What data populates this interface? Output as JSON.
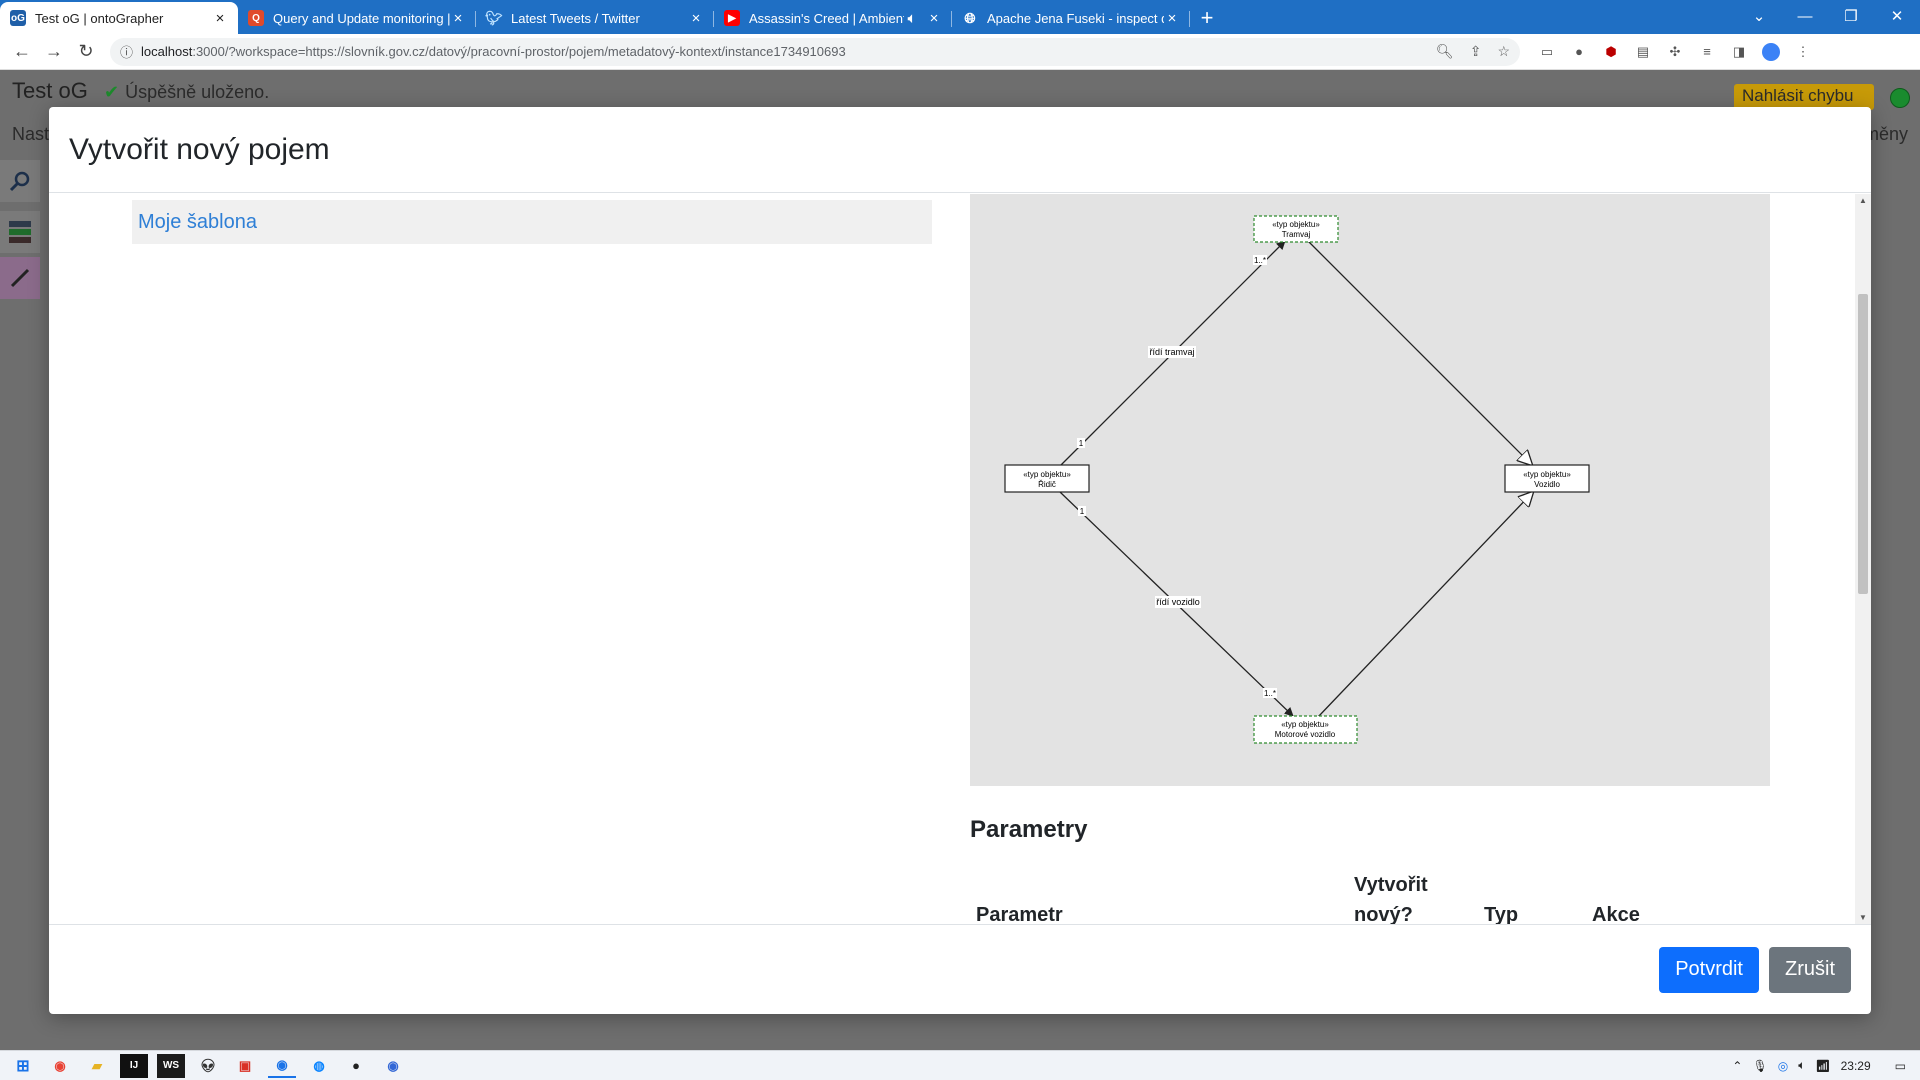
{
  "browser": {
    "tabs": [
      {
        "title": "Test oG | ontoGrapher",
        "favicon_color": "#1f5fa8",
        "active": true
      },
      {
        "title": "Query and Update monitoring | C",
        "favicon_color": "#e04a2b",
        "active": false
      },
      {
        "title": "Latest Tweets / Twitter",
        "favicon_color": "#1da1f2",
        "active": false
      },
      {
        "title": "Assassin's Creed | Ambient S",
        "favicon_color": "#ff0000",
        "active": false
      },
      {
        "title": "Apache Jena Fuseki - inspect dat",
        "favicon_color": "#555555",
        "active": false
      }
    ],
    "url_host": "localhost",
    "url_path": ":3000/?workspace=https://slovník.gov.cz/datový/pracovní-prostor/pojem/metadatový-kontext/instance1734910693"
  },
  "app": {
    "title": "Test oG",
    "saved_status": "Úspěšně uloženo.",
    "report_button": "Nahlásit chybu",
    "left_text": "Nast",
    "right_text": "měny",
    "status_color": "#1a8b2e"
  },
  "modal": {
    "title": "Vytvořit nový pojem",
    "template_item": "Moje šablona",
    "diagram": {
      "nodes": [
        {
          "stereotype": "«typ objektu»",
          "name": "Tramvaj"
        },
        {
          "stereotype": "«typ objektu»",
          "name": "Řidič"
        },
        {
          "stereotype": "«typ objektu»",
          "name": "Vozidlo"
        },
        {
          "stereotype": "«typ objektu»",
          "name": "Motorové vozidlo"
        }
      ],
      "edges": [
        {
          "label": "řídí tramvaj",
          "source_card": "1",
          "target_card": "1..*"
        },
        {
          "label": "řídí vozidlo",
          "source_card": "1",
          "target_card": "1..*"
        }
      ]
    },
    "params_title": "Parametry",
    "param_headers": {
      "param": "Parametr",
      "create_new_1": "Vytvořit",
      "create_new_2": "nový?",
      "type": "Typ",
      "action": "Akce"
    },
    "confirm_button": "Potvrdit",
    "cancel_button": "Zrušit"
  },
  "taskbar": {
    "time": "23:29"
  }
}
